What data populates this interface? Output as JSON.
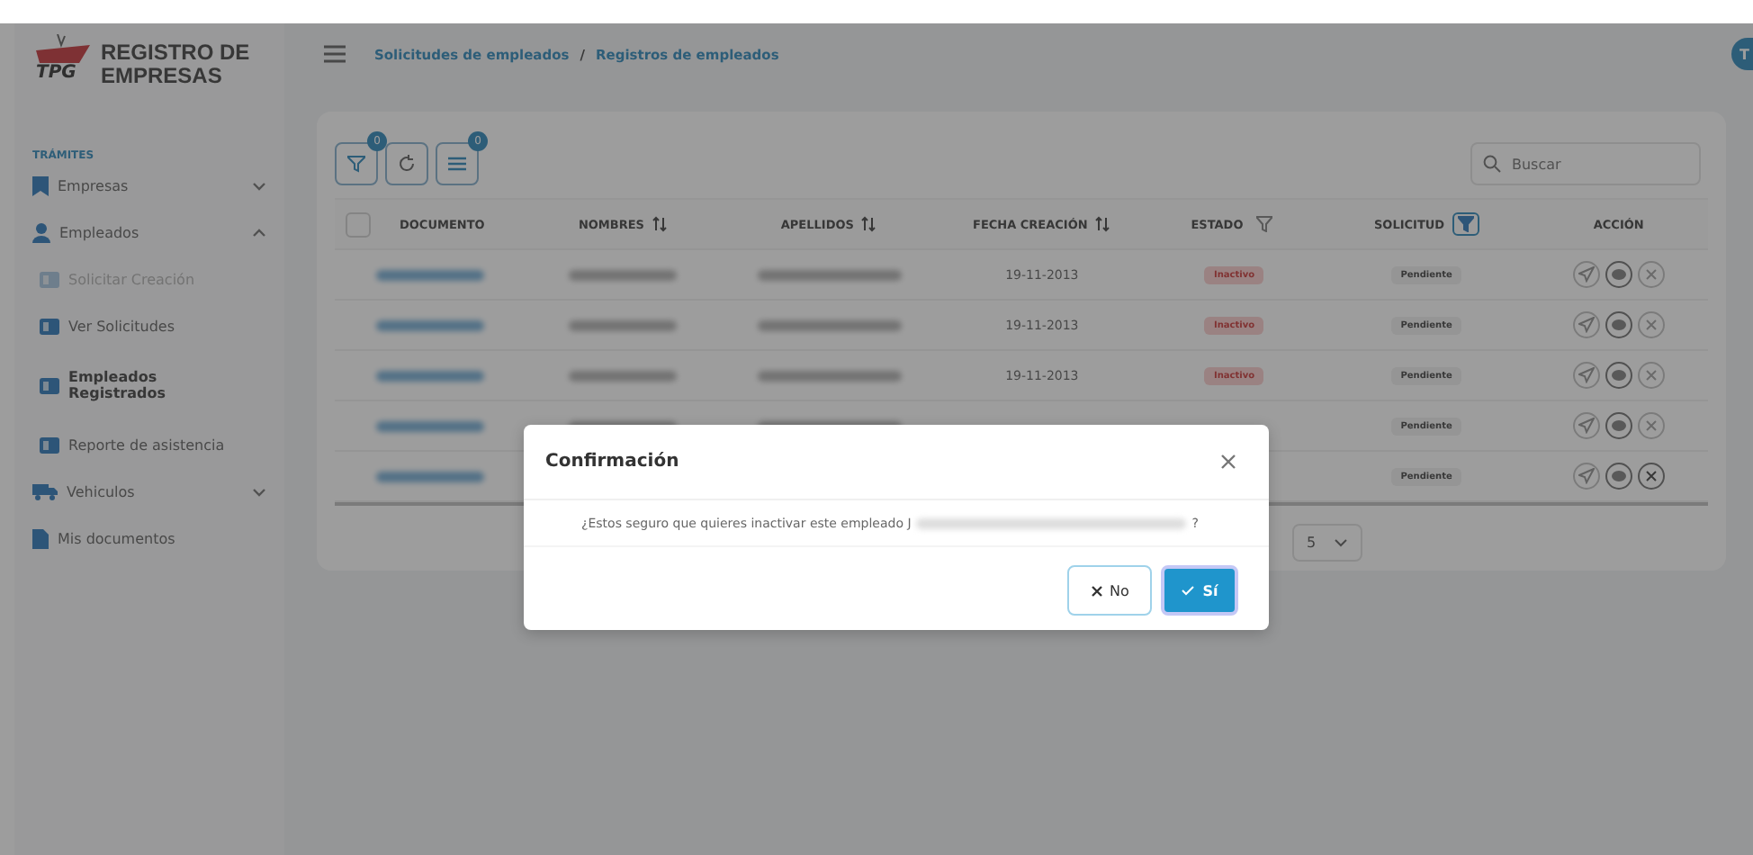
{
  "brand": {
    "logo": "TPG",
    "line1": "REGISTRO DE",
    "line2": "EMPRESAS"
  },
  "breadcrumb": [
    "Solicitudes de empleados",
    "/",
    "Registros de empleados"
  ],
  "avatar": "T",
  "sidebar": {
    "section": "TRÁMITES",
    "items": [
      {
        "label": "Empresas",
        "kind": "group",
        "expanded": false
      },
      {
        "label": "Empleados",
        "kind": "group",
        "expanded": true,
        "children": [
          {
            "label": "Solicitar Creación",
            "selected": false,
            "disabled": true
          },
          {
            "label": "Ver Solicitudes",
            "selected": false,
            "disabled": false
          },
          {
            "label": "Empleados Registrados",
            "selected": true,
            "disabled": false
          },
          {
            "label": "Reporte de asistencia",
            "selected": false,
            "disabled": false
          }
        ]
      },
      {
        "label": "Vehiculos",
        "kind": "group",
        "expanded": false
      },
      {
        "label": "Mis documentos",
        "kind": "link"
      }
    ]
  },
  "toolbar": [
    {
      "kind": "filter",
      "badge": "0"
    },
    {
      "kind": "refresh"
    },
    {
      "kind": "columns",
      "badge": "0"
    }
  ],
  "search": {
    "placeholder": "Buscar"
  },
  "table": {
    "header_checkbox": {
      "checked": false
    },
    "columns": [
      {
        "label": "DOCUMENTO",
        "kind": "plain"
      },
      {
        "label": "NOMBRES",
        "kind": "sort"
      },
      {
        "label": "APELLIDOS",
        "kind": "sort"
      },
      {
        "label": "FECHA CREACIÓN",
        "kind": "sort"
      },
      {
        "label": "ESTADO",
        "kind": "filter",
        "filtered": false
      },
      {
        "label": "SOLICITUD",
        "kind": "filter",
        "filtered": true
      },
      {
        "label": "ACCIÓN",
        "kind": "plain"
      }
    ],
    "rows": [
      {
        "kind": "full",
        "fecha": "19-11-2013",
        "estado": "Inactivo",
        "solicitud": "Pendiente",
        "active": false
      },
      {
        "kind": "full",
        "fecha": "19-11-2013",
        "estado": "Inactivo",
        "solicitud": "Pendiente",
        "active": false
      },
      {
        "kind": "full",
        "fecha": "19-11-2013",
        "estado": "Inactivo",
        "solicitud": "Pendiente",
        "active": false
      },
      {
        "kind": "full",
        "solicitud": "Pendiente",
        "active": false
      },
      {
        "kind": "covered",
        "solicitud": "Pendiente",
        "active": true
      }
    ]
  },
  "pagination": {
    "page_size": "5"
  },
  "modal": {
    "title": "Confirmación",
    "message": "¿Estos seguro que quieres inactivar este empleado J",
    "message_end": "?",
    "buttons": [
      {
        "label": "No",
        "kind": "cancel"
      },
      {
        "label": "Sí",
        "kind": "confirm"
      }
    ]
  }
}
